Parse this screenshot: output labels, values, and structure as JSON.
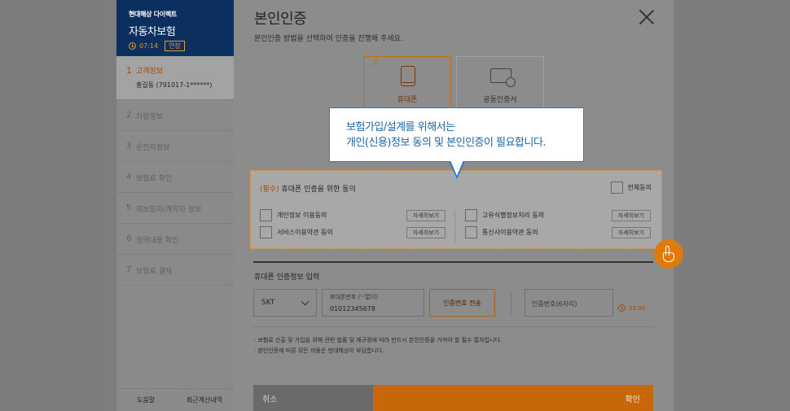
{
  "sidebar": {
    "brand_small": "현대해상 다이렉트",
    "brand_title": "자동차보험",
    "timer": "07:14",
    "extend_label": "연장",
    "steps": [
      {
        "num": "1",
        "label": "고객정보",
        "user": "홍길동 (791017-1******)"
      },
      {
        "num": "2",
        "label": "차량정보"
      },
      {
        "num": "3",
        "label": "운전자정보"
      },
      {
        "num": "4",
        "label": "보험료 확인"
      },
      {
        "num": "5",
        "label": "피보험자/계약자 정보"
      },
      {
        "num": "6",
        "label": "청약내용 확인"
      },
      {
        "num": "7",
        "label": "보험료 결제"
      }
    ],
    "bottom_help": "도움말",
    "bottom_history": "최근계산내역"
  },
  "main": {
    "title": "본인인증",
    "subtitle": "본인인증 방법을 선택하여 인증을 진행해 주세요.",
    "methods": {
      "phone": "휴대폰",
      "cert": "공동인증서"
    },
    "tooltip": {
      "line1": "보험가입/설계를 위해서는",
      "line2": "개인(신용)정보 동의 및 본인인증이 필요합니다."
    },
    "consent": {
      "required_tag": "(필수)",
      "title": "휴대폰 인증을 위한 동의",
      "all_agree": "전체동의",
      "detail_label": "자세히보기",
      "items": [
        "개인정보 이용동의",
        "서비스이용약관 동의",
        "고유식별정보처리 동의",
        "통신사이용약관 동의"
      ]
    },
    "input_section": {
      "title": "휴대폰 인증정보 입력",
      "carrier": "SKT",
      "phone_placeholder": "휴대폰번호 ('-'없이)",
      "phone_value": "01012345678",
      "send_label": "인증번호 전송",
      "code_placeholder": "인증번호(6자리)",
      "countdown": "03:00"
    },
    "notes": [
      "보험료 산출 및 가입을 위해 관련 법률 및 제규정에 따라 반드시 본인인증을 거쳐야 할 필수 절차입니다.",
      "본인인증에 따른 모든 비용은 현대해상이 부담합니다."
    ],
    "cancel_label": "취소",
    "confirm_label": "확인"
  },
  "colors": {
    "accent": "#c8670a",
    "brand": "#0b2f5f",
    "tooltip": "#2a7bbf"
  }
}
